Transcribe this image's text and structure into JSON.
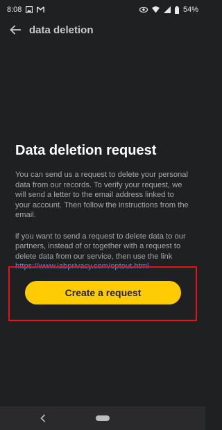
{
  "status_bar": {
    "time": "8:08",
    "left_icons": [
      "image-notification-icon",
      "gmail-icon"
    ],
    "right_icons": [
      "eye-icon",
      "wifi-icon",
      "signal-icon",
      "battery-icon"
    ],
    "battery": "54%"
  },
  "app_bar": {
    "title": "data deletion",
    "back_icon": "arrow-left-icon"
  },
  "main": {
    "heading": "Data deletion request",
    "paragraph1": "You can send us a request to delete your personal data from our records. To verify your request, we will send a letter to the email address linked to your account. Then follow the instructions from the email.",
    "paragraph2_prefix": "if you want to send a request to delete data to our partners, instead of or together with a request to delete data from our service, then use the link ",
    "paragraph2_link": "https://www.iabprivacy.com/optout.html",
    "cta_label": "Create a request"
  },
  "colors": {
    "background": "#1f2022",
    "accent": "#ffcb05",
    "link": "#4c8ff0",
    "highlight_frame": "#e5121b"
  },
  "nav_bar": {
    "icons": [
      "nav-back-icon",
      "nav-home-pill-icon"
    ]
  }
}
